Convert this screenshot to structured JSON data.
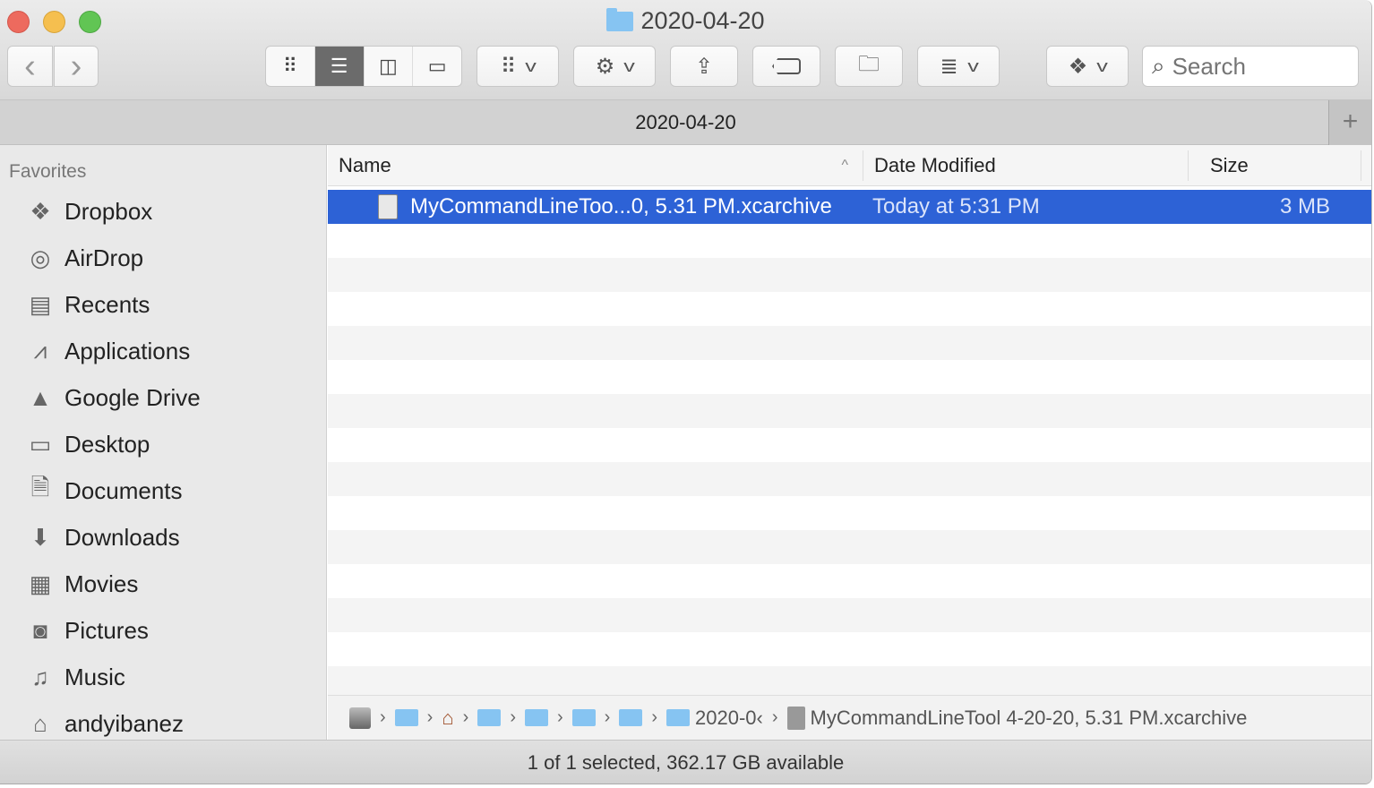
{
  "window": {
    "title": "2020-04-20",
    "tab_title": "2020-04-20"
  },
  "toolbar": {
    "back": "‹",
    "forward": "›",
    "search_placeholder": "Search",
    "view_modes": [
      "icon-view",
      "list-view",
      "column-view",
      "gallery-view"
    ],
    "active_view": "list-view"
  },
  "sidebar": {
    "header": "Favorites",
    "items": [
      {
        "label": "Dropbox",
        "icon": "dropbox-icon"
      },
      {
        "label": "AirDrop",
        "icon": "airdrop-icon"
      },
      {
        "label": "Recents",
        "icon": "recents-icon"
      },
      {
        "label": "Applications",
        "icon": "applications-icon"
      },
      {
        "label": "Google Drive",
        "icon": "google-drive-icon"
      },
      {
        "label": "Desktop",
        "icon": "desktop-icon"
      },
      {
        "label": "Documents",
        "icon": "documents-icon"
      },
      {
        "label": "Downloads",
        "icon": "downloads-icon"
      },
      {
        "label": "Movies",
        "icon": "movies-icon"
      },
      {
        "label": "Pictures",
        "icon": "pictures-icon"
      },
      {
        "label": "Music",
        "icon": "music-icon"
      },
      {
        "label": "andyibanez",
        "icon": "home-icon"
      }
    ]
  },
  "columns": {
    "name": "Name",
    "date": "Date Modified",
    "size": "Size",
    "sort": "name-ascending"
  },
  "files": [
    {
      "name": "MyCommandLineToo...0, 5.31 PM.xcarchive",
      "date": "Today at 5:31 PM",
      "size": "3 MB",
      "selected": true
    }
  ],
  "pathbar": {
    "current_folder": "2020-0‹",
    "file": "MyCommandLineTool 4-20-20, 5.31 PM.xcarchive"
  },
  "status": "1 of 1 selected, 362.17 GB available",
  "colors": {
    "selection": "#2d62d6",
    "folder": "#86c4f2"
  }
}
